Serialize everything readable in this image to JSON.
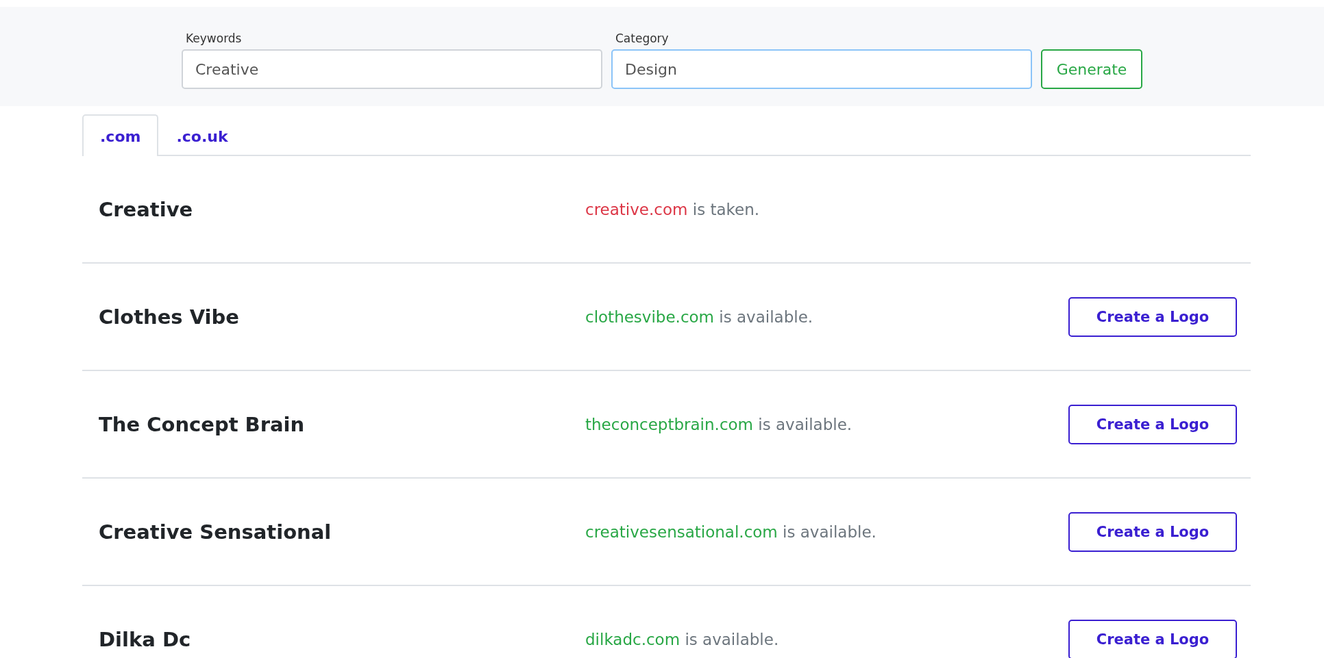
{
  "search": {
    "fields": [
      {
        "label": "Keywords",
        "value": "Creative",
        "focused": false
      },
      {
        "label": "Category",
        "value": "Design",
        "focused": true
      }
    ],
    "button": "Generate"
  },
  "tabs": [
    {
      "label": ".com",
      "selected": true
    },
    {
      "label": ".co.uk",
      "selected": false
    }
  ],
  "results": [
    {
      "name": "Creative",
      "domain": "creative.com",
      "kind": "taken",
      "message": "is taken."
    },
    {
      "name": "Clothes Vibe",
      "domain": "clothesvibe.com",
      "kind": "available",
      "message": "is available.",
      "button": "Create a Logo"
    },
    {
      "name": "The Concept Brain",
      "domain": "theconceptbrain.com",
      "kind": "available",
      "message": "is available.",
      "button": "Create a Logo"
    },
    {
      "name": "Creative Sensational",
      "domain": "creativesensational.com",
      "kind": "available",
      "message": "is available.",
      "button": "Create a Logo"
    },
    {
      "name": "Dilka Dc",
      "domain": "dilkadc.com",
      "kind": "available",
      "message": "is available.",
      "button": "Create a Logo"
    }
  ]
}
